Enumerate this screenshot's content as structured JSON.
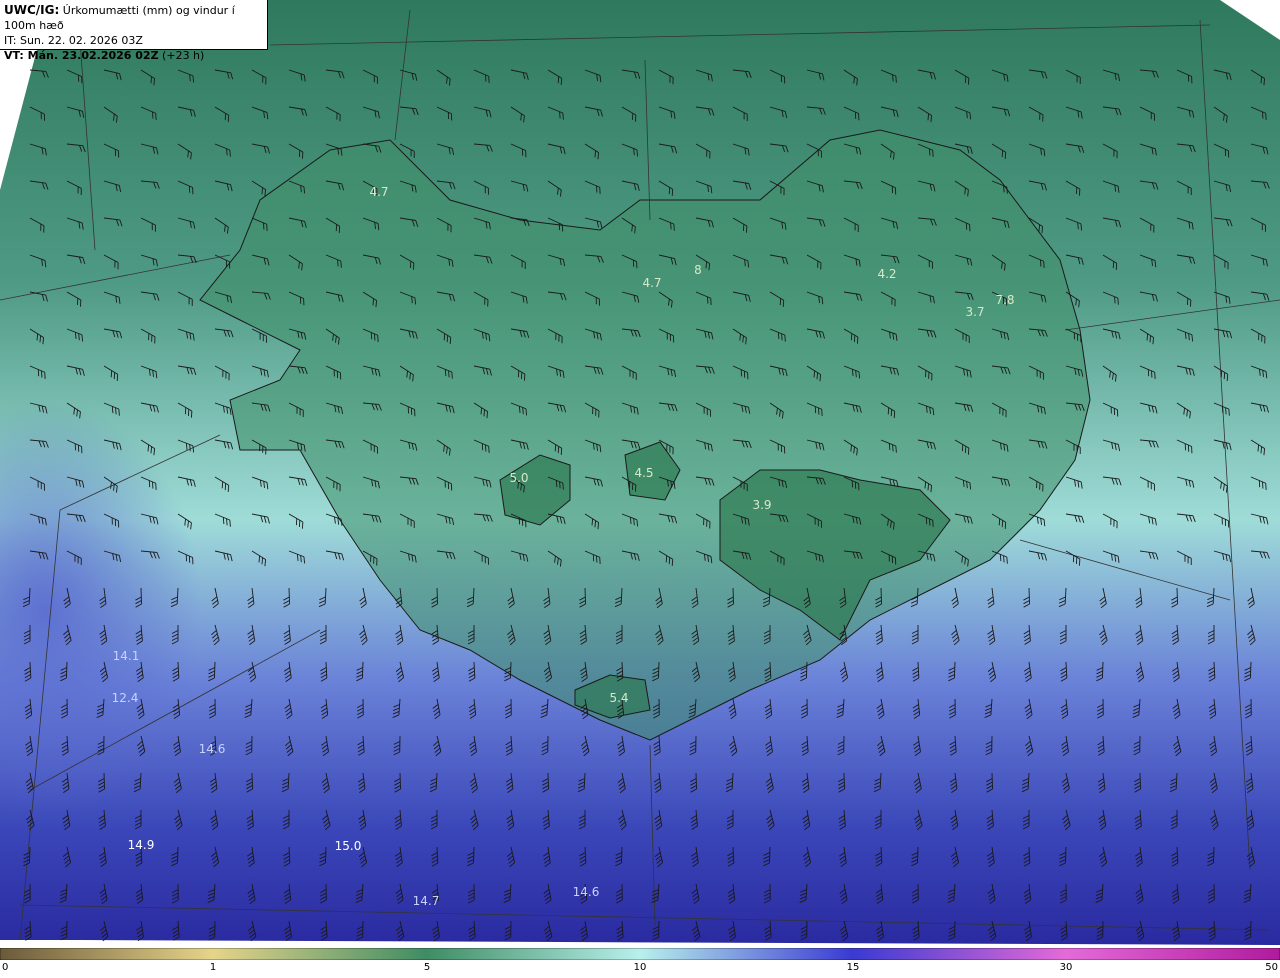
{
  "header": {
    "model": "UWC/IG:",
    "title_rest": " Úrkomumætti (mm) og vindur í 100m hæð",
    "issue_time": "IT: Sun. 22. 02. 2026 03Z",
    "valid_label": "VT: Mán. 23.02.2026 02Z",
    "valid_offset": " (+23 h)"
  },
  "map_values": [
    {
      "label": "4.7",
      "tone": "light"
    },
    {
      "label": "4.7",
      "tone": "light"
    },
    {
      "label": "8",
      "tone": "light"
    },
    {
      "label": "4.2",
      "tone": "light"
    },
    {
      "label": "3.7",
      "tone": "light"
    },
    {
      "label": "7.8",
      "tone": "light"
    },
    {
      "label": "5.0",
      "tone": "light"
    },
    {
      "label": "4.5",
      "tone": "light"
    },
    {
      "label": "3.9",
      "tone": "light"
    },
    {
      "label": "5.4",
      "tone": "light"
    },
    {
      "label": "14.1",
      "tone": "blue"
    },
    {
      "label": "12.4",
      "tone": "blue"
    },
    {
      "label": "14.6",
      "tone": "blue"
    },
    {
      "label": "14.9",
      "tone": "bright"
    },
    {
      "label": "15.0",
      "tone": "bright"
    },
    {
      "label": "14.7",
      "tone": "blue"
    },
    {
      "label": "14.6",
      "tone": "blue"
    }
  ],
  "colorbar": {
    "ticks": [
      "0",
      "1",
      "5",
      "10",
      "15",
      "30",
      "50"
    ],
    "colors": [
      "#6b5a3a",
      "#e6d48a",
      "#3f8c64",
      "#b8f0ec",
      "#3a3ad2",
      "#e46ad8",
      "#b01a9e"
    ]
  }
}
